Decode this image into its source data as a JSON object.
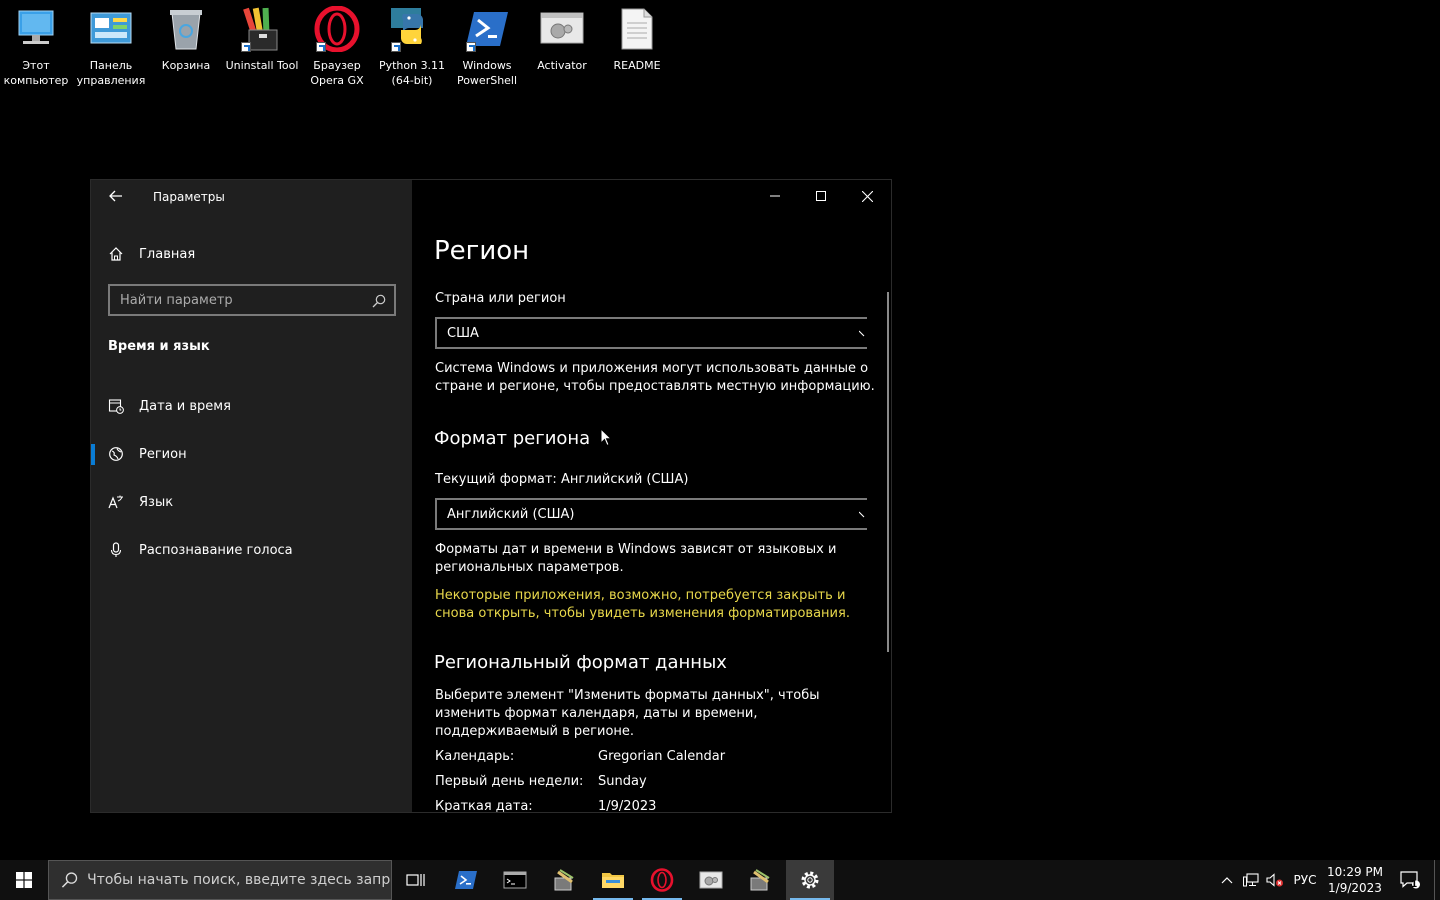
{
  "desktop": {
    "icons": [
      {
        "label": "Этот\nкомпьютер",
        "icon": "this-pc-icon"
      },
      {
        "label": "Панель\nуправления",
        "icon": "control-panel-icon"
      },
      {
        "label": "Корзина",
        "icon": "recycle-bin-icon"
      },
      {
        "label": "Uninstall Tool",
        "icon": "uninstall-tool-icon"
      },
      {
        "label": "Браузер\nOpera GX",
        "icon": "opera-gx-icon"
      },
      {
        "label": "Python 3.11\n(64-bit)",
        "icon": "python-icon"
      },
      {
        "label": "Windows\nPowerShell",
        "icon": "powershell-icon"
      },
      {
        "label": "Activator",
        "icon": "activator-icon"
      },
      {
        "label": "README",
        "icon": "text-file-icon"
      }
    ]
  },
  "window": {
    "title": "Параметры",
    "sidebar": {
      "home_label": "Главная",
      "search_placeholder": "Найти параметр",
      "section_title": "Время и язык",
      "items": [
        {
          "label": "Дата и время",
          "icon": "date-time-icon"
        },
        {
          "label": "Регион",
          "icon": "region-globe-icon",
          "active": true
        },
        {
          "label": "Язык",
          "icon": "language-icon"
        },
        {
          "label": "Распознавание голоса",
          "icon": "microphone-icon"
        }
      ]
    },
    "content": {
      "page_title": "Регион",
      "country_label": "Страна или регион",
      "country_value": "США",
      "country_desc": "Система Windows и приложения могут использовать данные о стране и регионе, чтобы предоставлять местную информацию.",
      "format_heading": "Формат региона",
      "current_format_label": "Текущий формат: Английский (США)",
      "format_value": "Английский (США)",
      "format_desc": "Форматы дат и времени в Windows зависят от языковых и региональных параметров.",
      "format_warning": "Некоторые приложения, возможно, потребуется закрыть и снова открыть, чтобы увидеть изменения форматирования.",
      "regional_heading": "Региональный формат данных",
      "regional_desc": "Выберите элемент \"Изменить форматы данных\", чтобы изменить формат календаря, даты и времени, поддерживаемый в регионе.",
      "rows": [
        {
          "key": "Календарь:",
          "value": "Gregorian Calendar"
        },
        {
          "key": "Первый день недели:",
          "value": "Sunday"
        },
        {
          "key": "Краткая дата:",
          "value": "1/9/2023"
        }
      ]
    },
    "colors": {
      "accent": "#0a7cd4",
      "warning": "#e8d84b",
      "sidebar_bg": "#1f1f1f"
    }
  },
  "taskbar": {
    "search_placeholder": "Чтобы начать поиск, введите здесь запрос",
    "language": "РУС",
    "time": "10:29 PM",
    "date": "1/9/2023",
    "notification_count": "1"
  }
}
